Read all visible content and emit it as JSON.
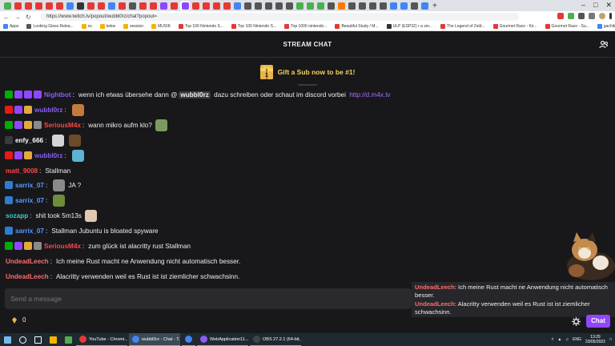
{
  "browser": {
    "url": "https://www.twitch.tv/popout/wubbl0rz/chat?popout=",
    "new_tab": "+",
    "window_controls": [
      "–",
      "□",
      "✕"
    ],
    "bookmarks": [
      {
        "label": "Apps",
        "color": "#4285f4"
      },
      {
        "label": "Looking Glass Relea...",
        "color": "#555555"
      },
      {
        "label": "ss",
        "color": "#f4b400"
      },
      {
        "label": "kekw",
        "color": "#f4b400"
      },
      {
        "label": "session",
        "color": "#f4b400"
      },
      {
        "label": "MUSIK",
        "color": "#f4b400"
      },
      {
        "label": "Top 100 Nintendo S...",
        "color": "#e53935"
      },
      {
        "label": "Top 100 Nintendo S...",
        "color": "#e53935"
      },
      {
        "label": "Top 1000 nintendo...",
        "color": "#e53935"
      },
      {
        "label": "Beautiful Study / M...",
        "color": "#e53935"
      },
      {
        "label": "ULP (ESP32) • a sm...",
        "color": "#333333"
      },
      {
        "label": "The Legend of Zeld...",
        "color": "#e53935"
      },
      {
        "label": "Gourmet Race - Kir...",
        "color": "#e53935"
      },
      {
        "label": "Gourmet Race - Su...",
        "color": "#e53935"
      },
      {
        "label": "gachibass gif - Goo...",
        "color": "#4285f4"
      }
    ]
  },
  "chat": {
    "header_title": "STREAM CHAT",
    "banner_text": "Gift a Sub now to be #1!",
    "gift_count": "1",
    "input_placeholder": "Send a message",
    "points_value": "0",
    "chat_button": "Chat",
    "messages": [
      {
        "user": "Nightbot",
        "color": "#8a5cf6",
        "badges": [
          "#00ad03",
          "#9147ff",
          "#9147ff",
          "#9147ff"
        ],
        "pre": "wenn ich etwas übersehe dann @",
        "mention": "wubbl0rz",
        "post": " dazu schreiben oder schaut im discord vorbei ",
        "link": "http://d.m4x.tv"
      },
      {
        "user": "wubbl0rz",
        "color": "#8a5cf6",
        "badges": [
          "#e91916",
          "#9147ff",
          "#e5a93b"
        ],
        "emotes": [
          "#c47a3d"
        ]
      },
      {
        "user": "SeriousM4x",
        "color": "#ff4545",
        "badges": [
          "#00ad03",
          "#9147ff",
          "#e5a93b",
          "#8a8a8a"
        ],
        "text": "wann mikro aufm klo?",
        "emotes_after": [
          "#7d9a5c"
        ]
      },
      {
        "user": "enfy_666",
        "color": "#ffffff",
        "badges": [
          "#3a3a3d"
        ],
        "emotes": [
          "#d4d4d4",
          "#6b4a2a"
        ]
      },
      {
        "user": "wubbl0rz",
        "color": "#8a5cf6",
        "badges": [
          "#e91916",
          "#9147ff",
          "#e5a93b"
        ],
        "emotes": [
          "#5bb4d4"
        ]
      },
      {
        "user": "matt_9008",
        "color": "#ff4545",
        "badges": [],
        "text": "Stallman"
      },
      {
        "user": "sarrix_07",
        "color": "#5b9bff",
        "badges": [
          "#2d7dd2"
        ],
        "text": "JA ?",
        "emotes": [
          "#8a8a8a"
        ]
      },
      {
        "user": "sarrix_07",
        "color": "#5b9bff",
        "badges": [
          "#2d7dd2"
        ],
        "emotes": [
          "#6e8c3a"
        ]
      },
      {
        "user": "sozapp",
        "color": "#34d1bf",
        "badges": [],
        "text": "shit took 5m13s",
        "emotes_after": [
          "#e0c9b0"
        ]
      },
      {
        "user": "sarrix_07",
        "color": "#5b9bff",
        "badges": [
          "#2d7dd2"
        ],
        "text": "Stallman Jubuntu is bloated spyware"
      },
      {
        "user": "SeriousM4x",
        "color": "#ff4545",
        "badges": [
          "#00ad03",
          "#9147ff",
          "#e5a93b",
          "#8a8a8a"
        ],
        "text": "zum glück ist alacritty rust Stallman"
      },
      {
        "user": "UndeadLeech",
        "color": "#ff6b6b",
        "badges": [],
        "text": "Ich meine Rust macht ne Anwendung nicht automatisch besser."
      },
      {
        "user": "UndeadLeech",
        "color": "#ff6b6b",
        "badges": [],
        "text": "Alacritty verwenden weil es Rust ist ist ziemlicher schwachsinn."
      }
    ]
  },
  "overlay": {
    "lines": [
      {
        "user": "UndeadLeech",
        "text": "Ich meine Rust macht ne Anwendung nicht automatisch besser."
      },
      {
        "user": "UndeadLeech",
        "text": "Alacritty verwenden weil es Rust ist ist ziemlicher schwachsinn."
      }
    ]
  },
  "taskbar": {
    "apps": [
      {
        "label": "YouTube - Chromi...",
        "color": "#e53935",
        "active": false
      },
      {
        "label": "wubbl0rz - Chat - T...",
        "color": "#4285f4",
        "active": true
      },
      {
        "label": "",
        "color": "#4285f4",
        "active": false
      },
      {
        "label": "WebApplication11...",
        "color": "#8a5cf6",
        "active": false
      },
      {
        "label": "OBS 27.2.1 (64-bit, ...",
        "color": "#444444",
        "active": false
      }
    ],
    "lang": "ENG",
    "time": "13:29",
    "date": "23/05/2022"
  }
}
